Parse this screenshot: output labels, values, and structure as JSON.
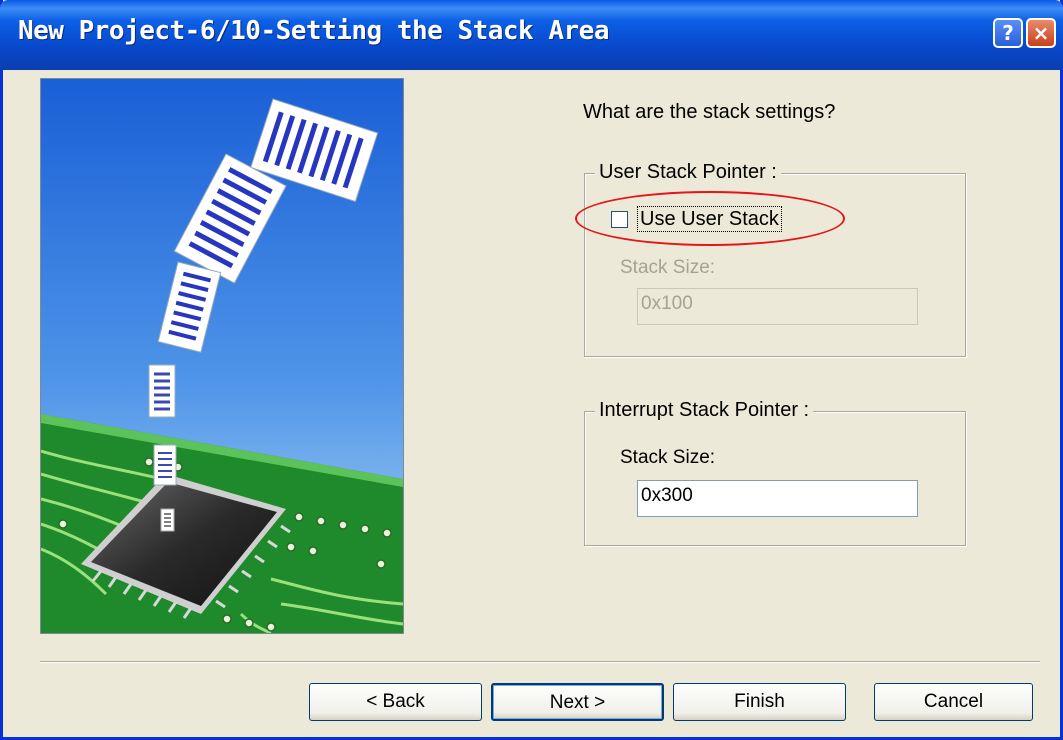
{
  "window": {
    "title": "New Project-6/10-Setting the Stack Area",
    "help_label": "?",
    "close_label": "×"
  },
  "question": "What are the stack settings?",
  "user_stack": {
    "legend": "User Stack Pointer :",
    "checkbox_label": "Use User Stack",
    "checked": false,
    "size_label": "Stack Size:",
    "size_value": "0x100",
    "enabled": false
  },
  "interrupt_stack": {
    "legend": "Interrupt Stack Pointer :",
    "size_label": "Stack Size:",
    "size_value": "0x300"
  },
  "buttons": {
    "back": "< Back",
    "next": "Next >",
    "finish": "Finish",
    "cancel": "Cancel"
  },
  "colors": {
    "title_bar": "#0b5fe6",
    "dialog_bg": "#ece9d8",
    "annotation": "#e8141a",
    "disabled_text": "#a5a291"
  }
}
